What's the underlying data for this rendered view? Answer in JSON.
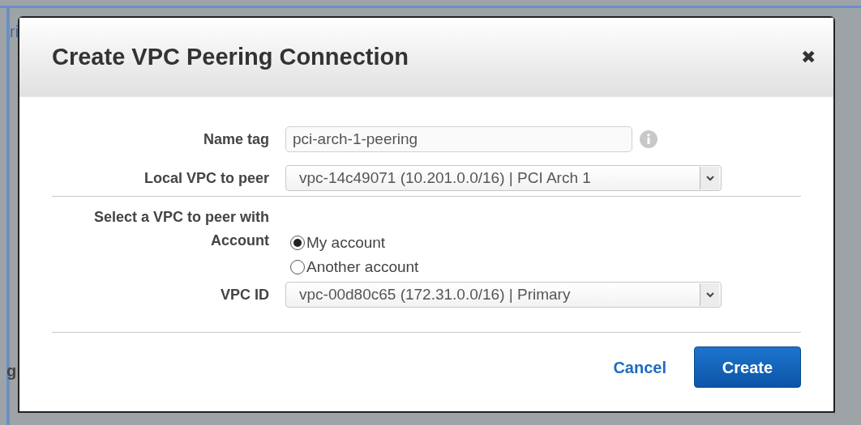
{
  "background": {
    "fragments": [
      {
        "text": "ri",
        "kind": "top-left"
      },
      {
        "text": "g",
        "kind": "bottom-left"
      }
    ]
  },
  "dialog": {
    "title": "Create VPC Peering Connection",
    "close": "✖",
    "name_tag": {
      "label": "Name tag",
      "value": "pci-arch-1-peering"
    },
    "local_vpc": {
      "label": "Local VPC to peer",
      "value": "vpc-14c49071 (10.201.0.0/16) | PCI Arch 1"
    },
    "section_title": "Select a VPC to peer with",
    "account": {
      "label": "Account",
      "options": [
        {
          "label": "My account",
          "selected": true
        },
        {
          "label": "Another account",
          "selected": false
        }
      ]
    },
    "vpc_id": {
      "label": "VPC ID",
      "value": "vpc-00d80c65 (172.31.0.0/16) | Primary"
    },
    "buttons": [
      {
        "label": "Cancel",
        "kind": "link"
      },
      {
        "label": "Create",
        "kind": "primary"
      }
    ]
  }
}
